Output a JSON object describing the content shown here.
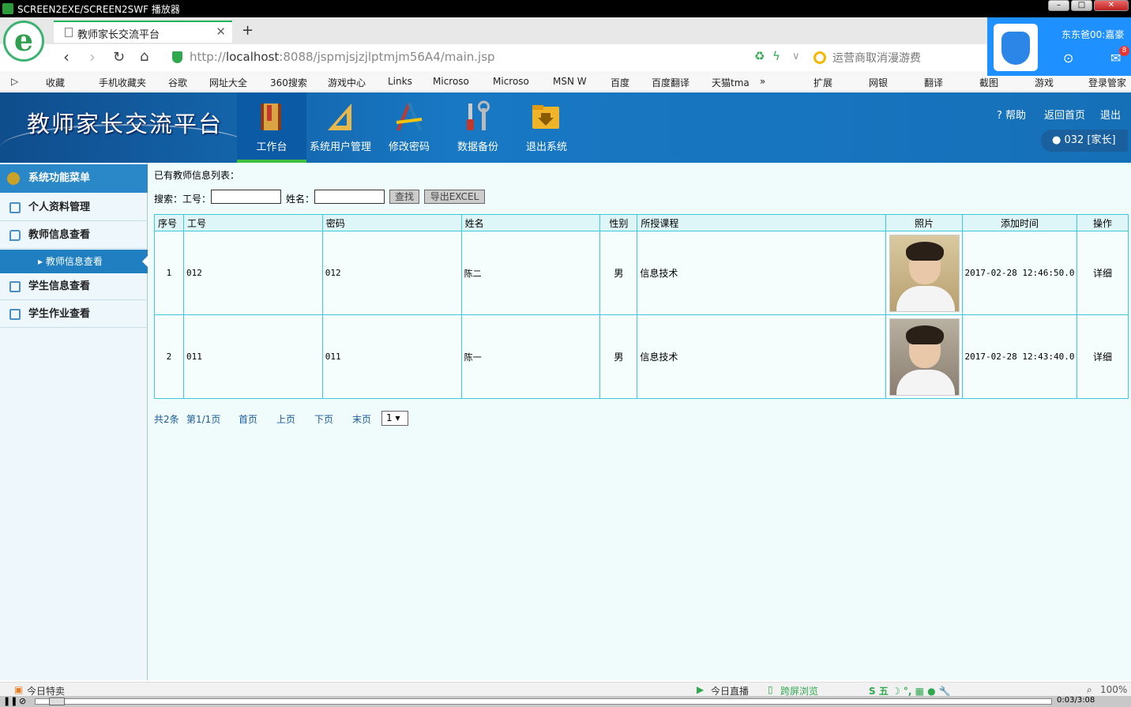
{
  "window": {
    "title": "SCREEN2EXE/SCREEN2SWF 播放器"
  },
  "browser": {
    "tab_title": "教师家长交流平台",
    "url_prefix": "http://",
    "url_host": "localhost",
    "url_rest": ":8088/jspmjsjzjlptmjm56A4/main.jsp",
    "search_text": "运营商取消漫游费",
    "bookmarks": [
      "收藏",
      "手机收藏夹",
      "谷歌",
      "网址大全",
      "360搜索",
      "游戏中心",
      "Links",
      "Microso",
      "Microso",
      "MSN W",
      "百度",
      "百度翻译",
      "天猫tma",
      "»",
      "扩展",
      "网银",
      "翻译",
      "截图",
      "游戏",
      "登录管家"
    ],
    "user_name": "东东爸00:嘉豪",
    "mail_count": "8"
  },
  "app": {
    "title": "教师家长交流平台",
    "nav": [
      "工作台",
      "系统用户管理",
      "修改密码",
      "数据备份",
      "退出系统"
    ],
    "help": "帮助",
    "home": "返回首页",
    "logout": "退出",
    "user": "032 [家长]"
  },
  "sidebar": {
    "header": "系统功能菜单",
    "items": [
      "个人资料管理",
      "教师信息查看",
      "学生信息查看",
      "学生作业查看"
    ],
    "sub_item": "教师信息查看"
  },
  "main": {
    "title": "已有教师信息列表：",
    "search_label": "搜索：",
    "id_label": "工号：",
    "name_label": "姓名：",
    "find_btn": "查找",
    "export_btn": "导出EXCEL",
    "columns": [
      "序号",
      "工号",
      "密码",
      "姓名",
      "性别",
      "所授课程",
      "照片",
      "添加时间",
      "操作"
    ],
    "rows": [
      {
        "no": "1",
        "id": "012",
        "pwd": "012",
        "name": "陈二",
        "sex": "男",
        "course": "信息技术",
        "time": "2017-02-28 12:46:50.0",
        "op": "详细"
      },
      {
        "no": "2",
        "id": "011",
        "pwd": "011",
        "name": "陈一",
        "sex": "男",
        "course": "信息技术",
        "time": "2017-02-28 12:43:40.0",
        "op": "详细"
      }
    ]
  },
  "pager": {
    "total": "共2条",
    "page": "第1/1页",
    "first": "首页",
    "prev": "上页",
    "next": "下页",
    "last": "末页",
    "select": "1 ▾"
  },
  "status": {
    "left": "今日特卖",
    "live": "今日直播",
    "cross": "跨屏浏览",
    "zoom": "100%"
  },
  "player": {
    "time": "0:03/3:08"
  }
}
